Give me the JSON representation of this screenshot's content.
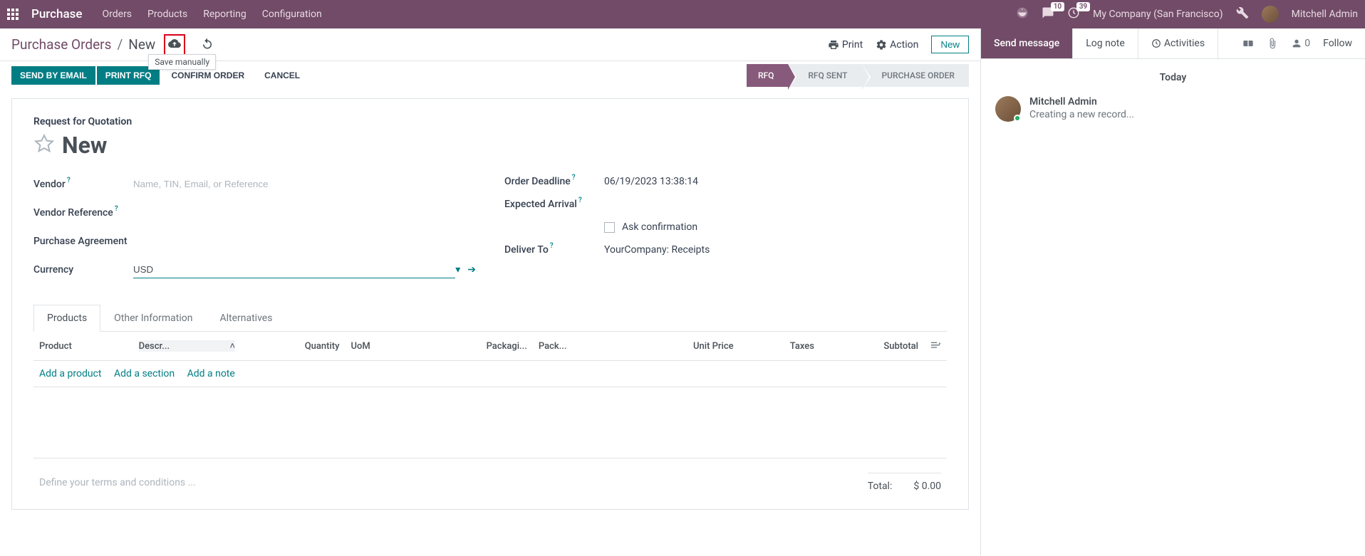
{
  "navbar": {
    "brand": "Purchase",
    "links": [
      "Orders",
      "Products",
      "Reporting",
      "Configuration"
    ],
    "messages_badge": "10",
    "activities_badge": "39",
    "company": "My Company (San Francisco)",
    "user": "Mitchell Admin"
  },
  "breadcrumb": {
    "parent": "Purchase Orders",
    "current": "New",
    "tooltip": "Save manually",
    "print": "Print",
    "action": "Action",
    "new": "New"
  },
  "actions": {
    "send_email": "SEND BY EMAIL",
    "print_rfq": "PRINT RFQ",
    "confirm": "CONFIRM ORDER",
    "cancel": "CANCEL"
  },
  "status": {
    "rfq": "RFQ",
    "rfq_sent": "RFQ SENT",
    "po": "PURCHASE ORDER"
  },
  "form": {
    "subtitle": "Request for Quotation",
    "title": "New",
    "vendor_label": "Vendor",
    "vendor_placeholder": "Name, TIN, Email, or Reference",
    "vendor_ref_label": "Vendor Reference",
    "agreement_label": "Purchase Agreement",
    "currency_label": "Currency",
    "currency_value": "USD",
    "deadline_label": "Order Deadline",
    "deadline_value": "06/19/2023 13:38:14",
    "arrival_label": "Expected Arrival",
    "ask_confirm": "Ask confirmation",
    "deliver_label": "Deliver To",
    "deliver_value": "YourCompany: Receipts"
  },
  "tabs": {
    "products": "Products",
    "other": "Other Information",
    "alternatives": "Alternatives"
  },
  "table": {
    "headers": {
      "product": "Product",
      "description": "Descr...",
      "quantity": "Quantity",
      "uom": "UoM",
      "packaging": "Packagi...",
      "pack": "Pack...",
      "unit_price": "Unit Price",
      "taxes": "Taxes",
      "subtotal": "Subtotal"
    },
    "add_product": "Add a product",
    "add_section": "Add a section",
    "add_note": "Add a note"
  },
  "totals": {
    "terms_placeholder": "Define your terms and conditions ...",
    "total_label": "Total:",
    "total_value": "$ 0.00"
  },
  "chatter": {
    "send": "Send message",
    "log": "Log note",
    "activities": "Activities",
    "follower_count": "0",
    "follow": "Follow",
    "today": "Today",
    "msg_author": "Mitchell Admin",
    "msg_text": "Creating a new record..."
  }
}
